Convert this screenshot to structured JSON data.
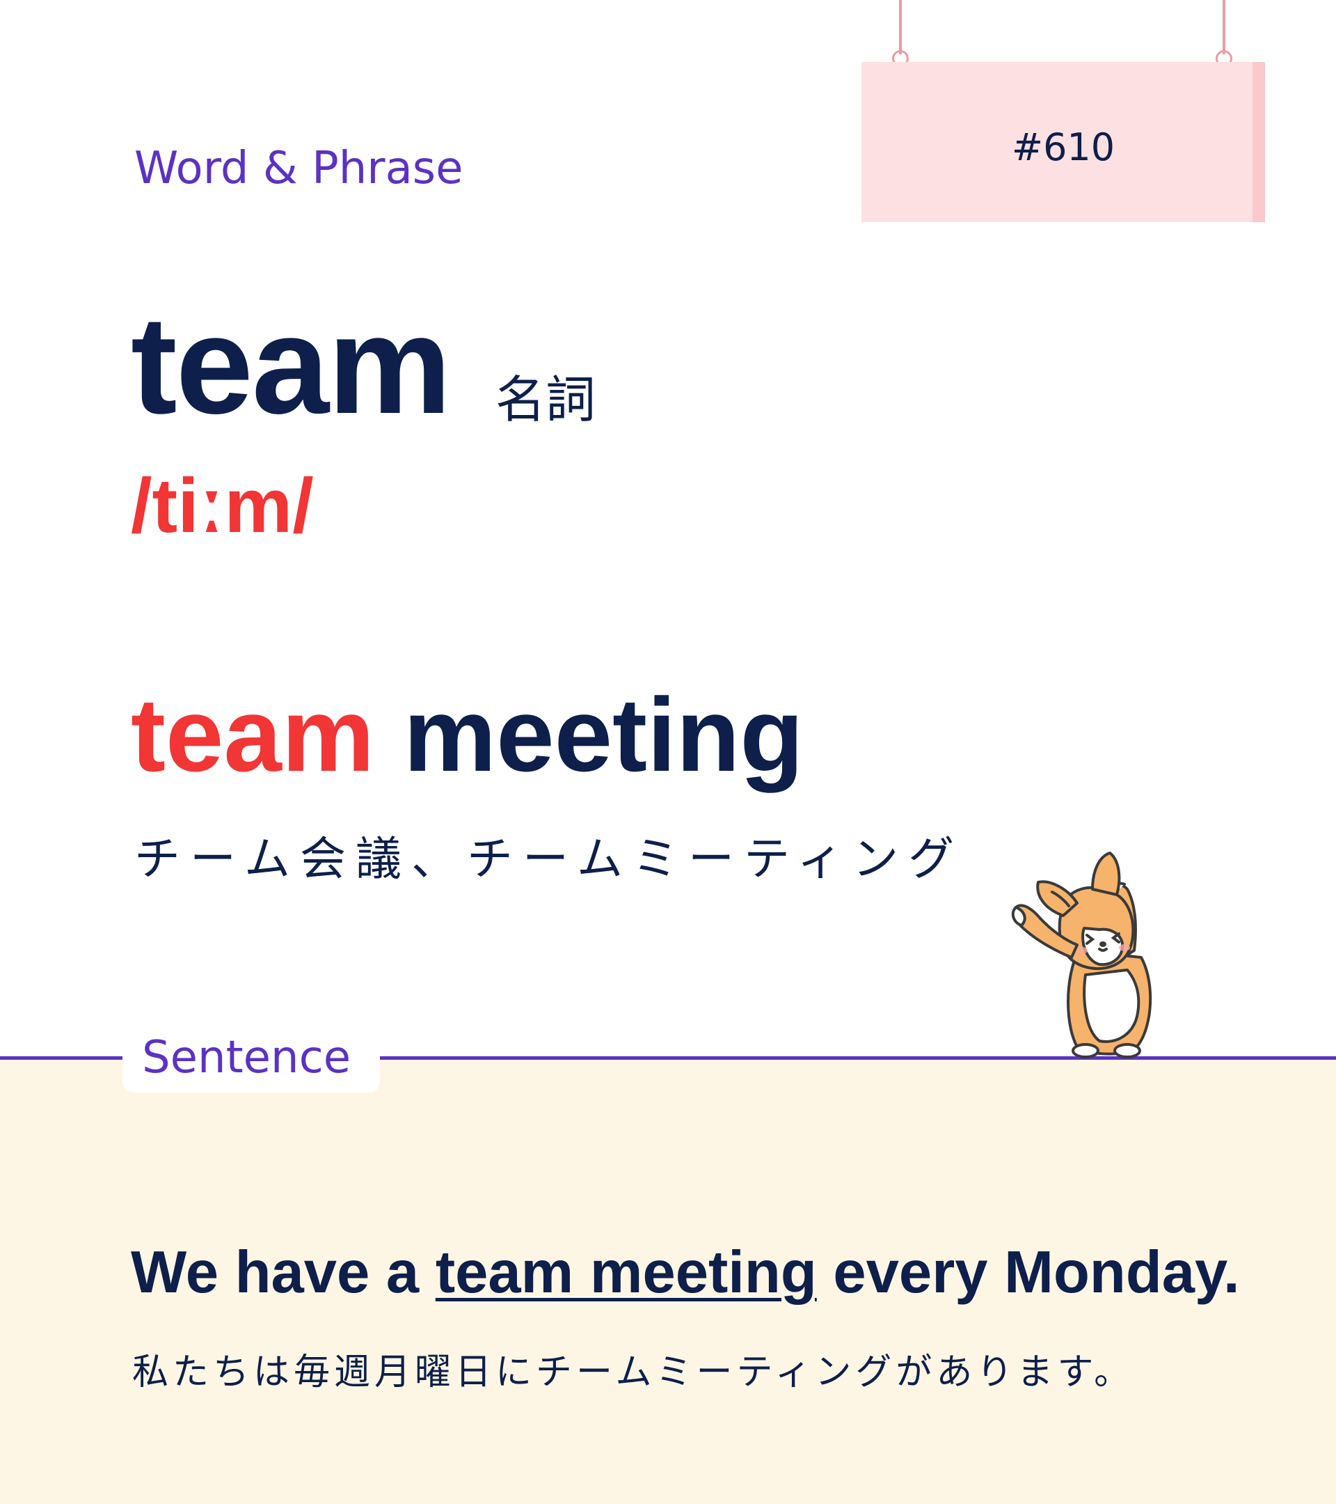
{
  "header": {
    "section_label": "Word & Phrase",
    "card_number": "#610"
  },
  "word": {
    "headword": "team",
    "part_of_speech": "名詞",
    "pronunciation": "/tiːm/"
  },
  "phrase": {
    "key": "team",
    "rest": " meeting",
    "translation": "チーム会議、チームミーティング"
  },
  "sentence": {
    "section_label": "Sentence",
    "before": "We have a ",
    "highlight": "team meeting",
    "after": " every Monday.",
    "translation": "私たちは毎週月曜日にチームミーティングがあります。"
  },
  "colors": {
    "accent_purple": "#5b32c4",
    "highlight_red": "#f23535",
    "text_navy": "#0d1f4a",
    "sign_pink": "#fde0e2",
    "sentence_bg": "#fdf6e4"
  },
  "mascot": {
    "icon": "corgi-mascot-icon"
  }
}
